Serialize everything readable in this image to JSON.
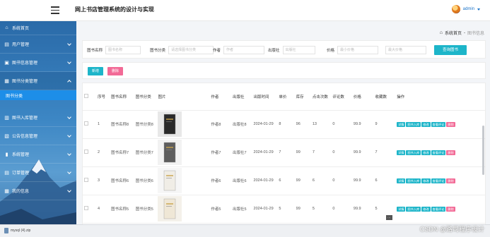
{
  "header": {
    "title": "网上书店管理系统的设计与实现",
    "user": "admin"
  },
  "sidebar": {
    "items": [
      {
        "label": "系统首页",
        "icon": "home-icon"
      },
      {
        "label": "用户管理",
        "icon": "user-icon"
      },
      {
        "label": "图书信息管理",
        "icon": "book-icon"
      },
      {
        "label": "图书分类管理",
        "icon": "category-icon"
      },
      {
        "label": "图书分类",
        "sub": true
      },
      {
        "label": "图书入库管理",
        "icon": "inbox-icon"
      },
      {
        "label": "公告信息管理",
        "icon": "notice-icon"
      },
      {
        "label": "系统管理",
        "icon": "system-icon"
      },
      {
        "label": "订单管理",
        "icon": "order-icon"
      },
      {
        "label": "我的信息",
        "icon": "profile-icon"
      }
    ]
  },
  "breadcrumb": {
    "home": "系统首页",
    "current": "图书信息"
  },
  "search": {
    "fields": [
      {
        "label": "图书名称",
        "placeholder": "图书名称"
      },
      {
        "label": "图书分类",
        "placeholder": "请选择图书分类"
      },
      {
        "label": "作者",
        "placeholder": "作者"
      },
      {
        "label": "出版社",
        "placeholder": "出版社"
      },
      {
        "label": "价格",
        "placeholder": "最小价格"
      },
      {
        "label": "",
        "placeholder": "最大价格"
      }
    ],
    "button": "查询图书"
  },
  "actions": {
    "add": "新增",
    "delete": "删除"
  },
  "table": {
    "headers": [
      "",
      "序号",
      "图书名称",
      "图书分类",
      "图片",
      "作者",
      "出版社",
      "出版时间",
      "单价",
      "库存",
      "点击次数",
      "评论数",
      "价格",
      "收藏数",
      "操作"
    ],
    "rows": [
      {
        "seq": "1",
        "name": "图书名称8",
        "category": "图书分类8",
        "author": "作者8",
        "publisher": "出版社8",
        "date": "2024-01-29",
        "unit": "8",
        "stock": "96",
        "clicks": "13",
        "comments": "0",
        "price": "99.9",
        "favorites": "9",
        "cover": "dark"
      },
      {
        "seq": "2",
        "name": "图书名称7",
        "category": "图书分类7",
        "author": "作者7",
        "publisher": "出版社7",
        "date": "2024-01-29",
        "unit": "7",
        "stock": "99",
        "clicks": "7",
        "comments": "0",
        "price": "99.9",
        "favorites": "7",
        "cover": "gray"
      },
      {
        "seq": "3",
        "name": "图书名称6",
        "category": "图书分类6",
        "author": "作者6",
        "publisher": "出版社6",
        "date": "2024-01-29",
        "unit": "6",
        "stock": "99",
        "clicks": "6",
        "comments": "0",
        "price": "99.9",
        "favorites": "6",
        "cover": "white"
      },
      {
        "seq": "4",
        "name": "图书名称5",
        "category": "图书分类5",
        "author": "作者5",
        "publisher": "出版社5",
        "date": "2024-01-29",
        "unit": "5",
        "stock": "99",
        "clicks": "5",
        "comments": "0",
        "price": "99.9",
        "favorites": "5",
        "cover": "cream"
      }
    ],
    "row_actions": [
      "详情",
      "图书入库",
      "修改",
      "查看评论",
      "删除"
    ]
  },
  "downloads": {
    "file": "mysql (4).zip"
  },
  "watermark": "CSDN @路司程序设计"
}
